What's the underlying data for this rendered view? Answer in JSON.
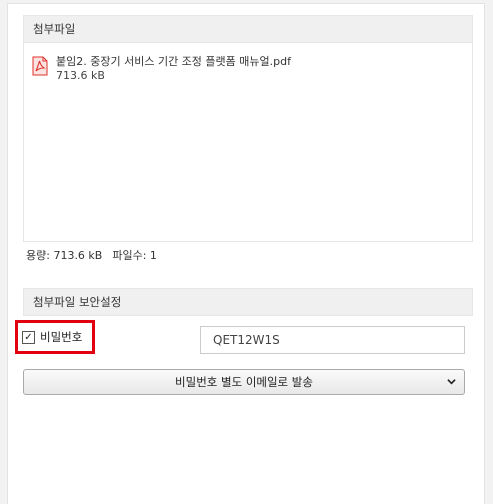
{
  "attachments": {
    "header": "첨부파일",
    "files": [
      {
        "name": "붙임2. 중장기 서비스 기간 조정 플랫폼 매뉴얼.pdf",
        "size": "713.6 kB",
        "icon": "pdf-icon"
      }
    ],
    "summary": {
      "capacity": "용량: 713.6 kB",
      "count": "파일수: 1"
    }
  },
  "security": {
    "header": "첨부파일 보안설정",
    "password_checkbox": {
      "label": "비밀번호",
      "checked": true
    },
    "password_value": "QET12W1S",
    "send_method": {
      "selected": "비밀번호 별도 이메일로 발송"
    }
  },
  "colors": {
    "highlight": "#e10010",
    "pdf": "#e0332a"
  }
}
